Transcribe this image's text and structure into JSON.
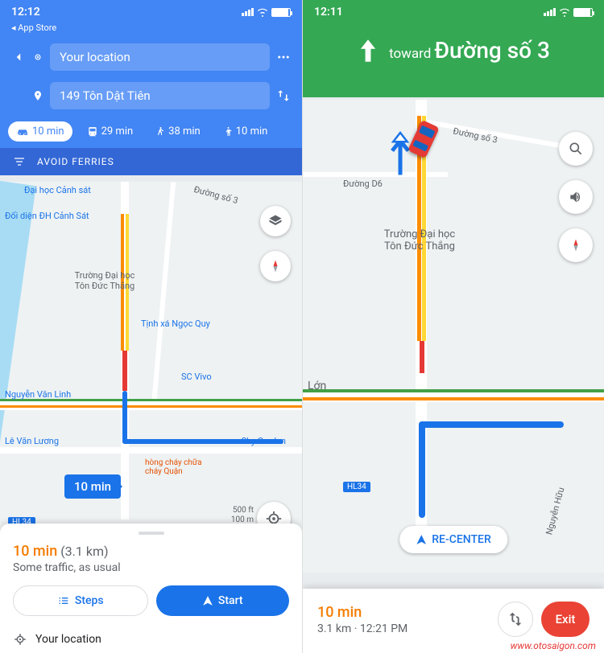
{
  "left": {
    "status": {
      "time": "12:12",
      "back_app": "App Store"
    },
    "route": {
      "from": "Your location",
      "to": "149 Tôn Dật Tiên"
    },
    "modes": {
      "car": "10 min",
      "transit": "29 min",
      "walk": "38 min",
      "ride": "10 min"
    },
    "avoid": "AVOID FERRIES",
    "map_labels": {
      "dh_canh_sat": "Đại học Cảnh sát",
      "doi_dien": "Đối diện ĐH Cảnh Sát",
      "truong_dh": "Trường Đại học Tôn Đức Thắng",
      "tinh_xa": "Tịnh xá Ngọc Quy",
      "sc_vivo": "SC Vivo",
      "nguyen_van_linh": "Nguyễn Văn Linh",
      "le_van_luong": "Lê Văn Lương",
      "sky_garden": "Sky Garden",
      "duong_so_3": "Đường số 3",
      "phong_chay": "hòng cháy chữa cháy Quận",
      "hl34": "HL34",
      "scale_ft": "500 ft",
      "scale_m": "100 m"
    },
    "route_badge": "10 min",
    "sheet": {
      "time": "10 min",
      "dist": "(3.1 km)",
      "traffic": "Some traffic, as usual",
      "steps": "Steps",
      "start": "Start",
      "your_loc": "Your location"
    }
  },
  "right": {
    "status": {
      "time": "12:11"
    },
    "nav": {
      "toward": "toward",
      "road": "Đường số 3"
    },
    "map_labels": {
      "duong_so_3": "Đường số 3",
      "duong_d6": "Đường D6",
      "truong_dh": "Trường Đại học Tôn Đức Thắng",
      "lon": "Lớn",
      "hl34": "HL34",
      "nguyen_huu": "Nguyễn Hữu"
    },
    "recenter": "RE-CENTER",
    "sheet": {
      "time": "10 min",
      "detail": "3.1 km · 12:21 PM",
      "exit": "Exit"
    }
  },
  "watermark": "www.otosaigon.com"
}
